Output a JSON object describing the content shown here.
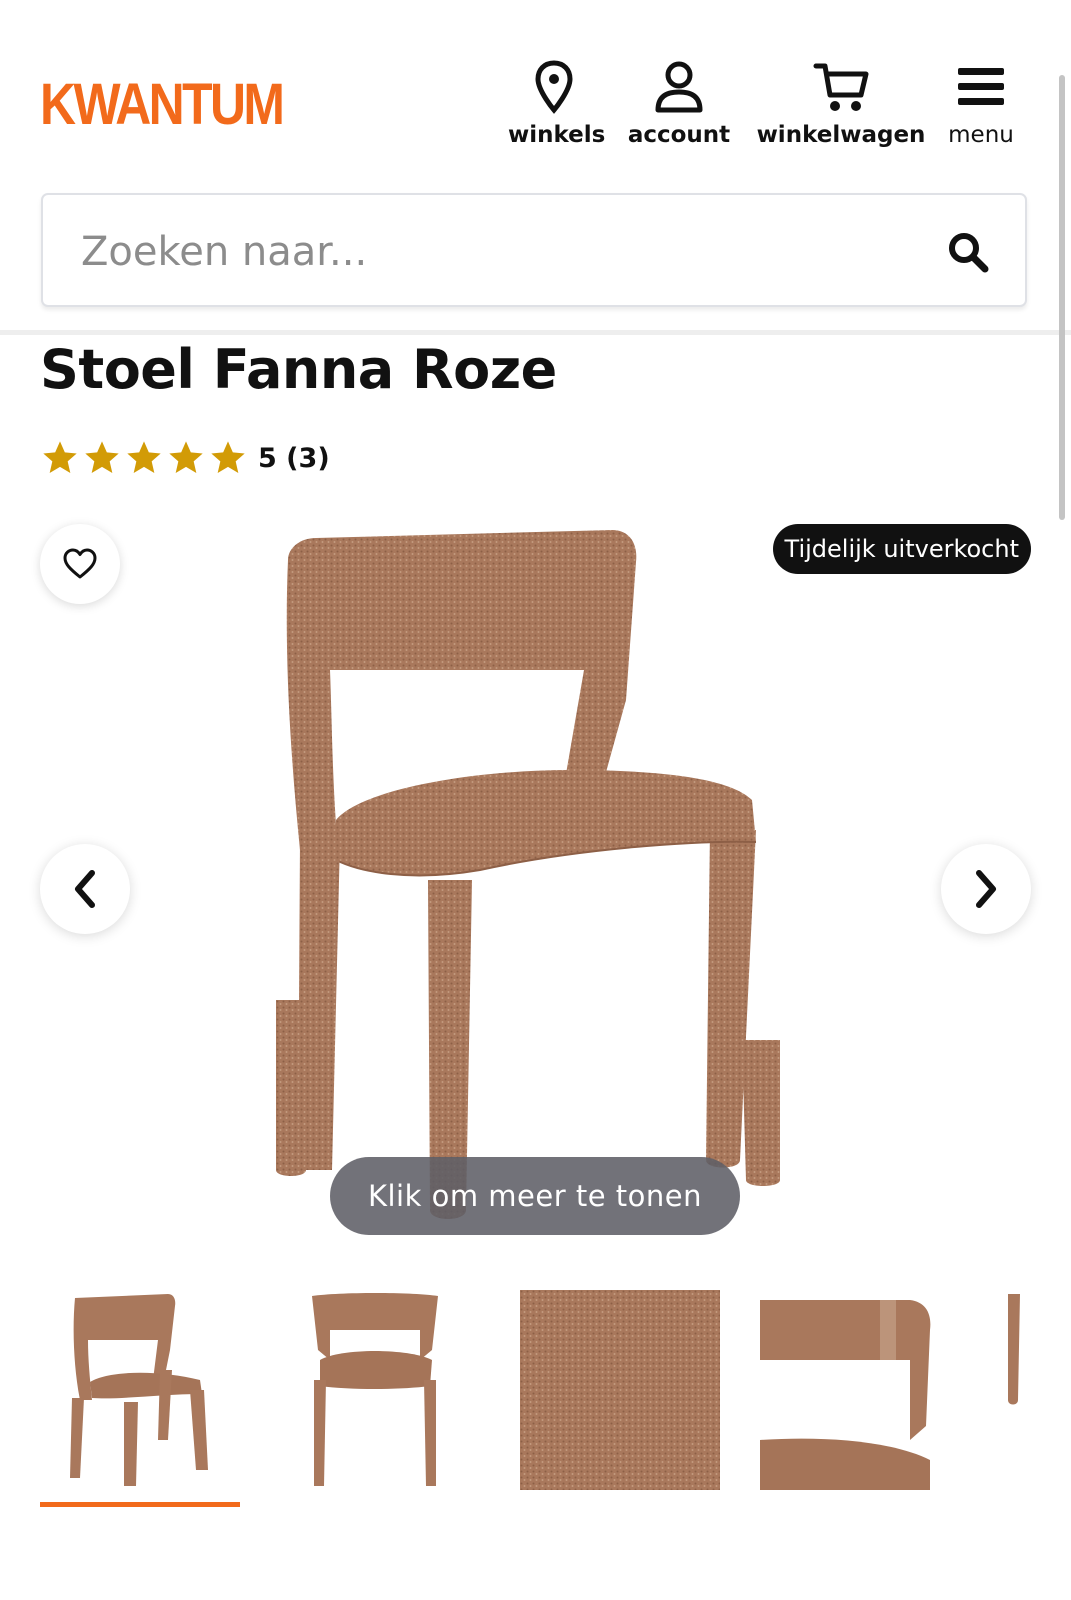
{
  "header": {
    "logo": "KWANTUM",
    "nav": [
      {
        "label": "winkels",
        "icon": "location-pin-icon"
      },
      {
        "label": "account",
        "icon": "user-icon"
      },
      {
        "label": "winkelwagen",
        "icon": "cart-icon"
      },
      {
        "label": "menu",
        "icon": "hamburger-icon"
      }
    ]
  },
  "search": {
    "placeholder": "Zoeken naar..."
  },
  "product": {
    "title": "Stoel Fanna Roze",
    "rating_text": "5 (3)",
    "rating_value": 5,
    "rating_max": 5
  },
  "gallery": {
    "status_badge": "Tijdelijk uitverkocht",
    "more_button": "Klik om meer te tonen",
    "active_thumbnail": 1,
    "thumbnails": [
      "chair-angle",
      "chair-front",
      "fabric-detail",
      "backrest-detail",
      "leg-detail"
    ]
  },
  "colors": {
    "brand_orange": "#f26a1b",
    "star_gold": "#d29b06",
    "fabric": "#a9785c"
  }
}
